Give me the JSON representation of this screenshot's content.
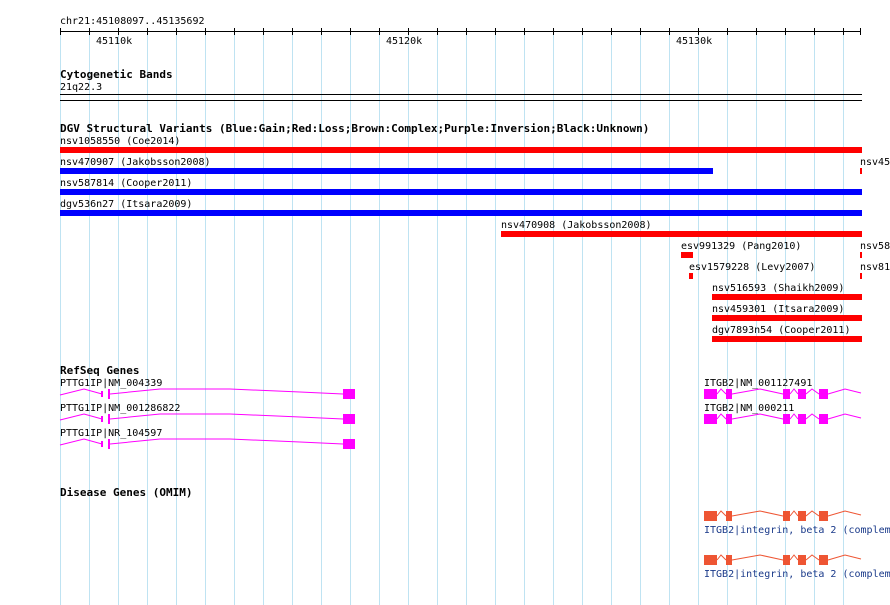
{
  "ruler": {
    "locus": "chr21:45108097..45135692",
    "ticks": [
      {
        "label": "45110k"
      },
      {
        "label": "45120k"
      },
      {
        "label": "45130k"
      }
    ]
  },
  "tracks": {
    "cytoband": {
      "title": "Cytogenetic Bands",
      "band": "21q22.3"
    },
    "dgv": {
      "title": "DGV Structural Variants (Blue:Gain;Red:Loss;Brown:Complex;Purple:Inversion;Black:Unknown)",
      "colors": {
        "gain": "#0000ff",
        "loss": "#ff0000"
      },
      "variants": [
        {
          "label": "nsv1058550 (Coe2014)",
          "type": "loss"
        },
        {
          "label": "nsv470907 (Jakobsson2008)",
          "type": "gain"
        },
        {
          "label": "nsv45",
          "type": "loss"
        },
        {
          "label": "nsv587814 (Cooper2011)",
          "type": "gain"
        },
        {
          "label": "dgv536n27 (Itsara2009)",
          "type": "gain"
        },
        {
          "label": "nsv470908 (Jakobsson2008)",
          "type": "loss"
        },
        {
          "label": "esv991329 (Pang2010)",
          "type": "loss"
        },
        {
          "label": "nsv58",
          "type": "loss"
        },
        {
          "label": "esv1579228 (Levy2007)",
          "type": "loss"
        },
        {
          "label": "nsv81",
          "type": "loss"
        },
        {
          "label": "nsv516593 (Shaikh2009)",
          "type": "loss"
        },
        {
          "label": "nsv459301 (Itsara2009)",
          "type": "loss"
        },
        {
          "label": "dgv7893n54 (Cooper2011)",
          "type": "loss"
        }
      ]
    },
    "refseq": {
      "title": "RefSeq Genes",
      "color": "#ff00ff",
      "genes": [
        {
          "label": "PTTG1IP|NM_004339"
        },
        {
          "label": "PTTG1IP|NM_001286822"
        },
        {
          "label": "PTTG1IP|NR_104597"
        },
        {
          "label": "ITGB2|NM_001127491"
        },
        {
          "label": "ITGB2|NM_000211"
        }
      ]
    },
    "omim": {
      "title": "Disease Genes (OMIM)",
      "color": "#ee5533",
      "genes": [
        {
          "label": "ITGB2|integrin, beta 2 (complem"
        },
        {
          "label": "ITGB2|integrin, beta 2 (complem"
        }
      ]
    }
  }
}
